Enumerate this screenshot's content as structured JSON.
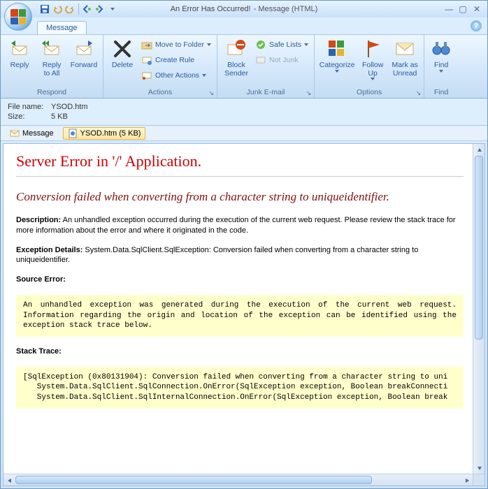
{
  "window": {
    "title_main": "An Error Has Occurred!",
    "title_sub": "- Message (HTML)"
  },
  "tabs": {
    "message": "Message"
  },
  "ribbon": {
    "respond": {
      "label": "Respond",
      "reply": "Reply",
      "reply_all": "Reply\nto All",
      "forward": "Forward"
    },
    "actions": {
      "label": "Actions",
      "delete": "Delete",
      "move_to_folder": "Move to Folder",
      "create_rule": "Create Rule",
      "other_actions": "Other Actions"
    },
    "junk": {
      "label": "Junk E-mail",
      "block": "Block\nSender",
      "safe_lists": "Safe Lists",
      "not_junk": "Not Junk"
    },
    "options": {
      "label": "Options",
      "categorize": "Categorize",
      "follow_up": "Follow\nUp",
      "mark_as_unread": "Mark as\nUnread"
    },
    "find": {
      "label": "Find",
      "find": "Find"
    }
  },
  "fileinfo": {
    "filename_label": "File name:",
    "filename": "YSOD.htm",
    "size_label": "Size:",
    "size": "5 KB"
  },
  "attachments": {
    "message_tab": "Message",
    "ysod_tab": "YSOD.htm (5 KB)"
  },
  "ysod": {
    "h1": "Server Error in '/' Application.",
    "h2": "Conversion failed when converting from a character string to uniqueidentifier.",
    "desc_label": "Description:",
    "desc": "An unhandled exception occurred during the execution of the current web request. Please review the stack trace for more information about the error and where it originated in the code.",
    "ex_label": "Exception Details:",
    "ex": "System.Data.SqlClient.SqlException: Conversion failed when converting from a character string to uniqueidentifier.",
    "src_label": "Source Error:",
    "src_box": "An unhandled exception was generated during the execution of the current web request. Information regarding the origin and location of the exception can be identified using the exception stack trace below.",
    "stack_label": "Stack Trace:",
    "stack_box": "[SqlException (0x80131904): Conversion failed when converting from a character string to uni\n   System.Data.SqlClient.SqlConnection.OnError(SqlException exception, Boolean breakConnecti\n   System.Data.SqlClient.SqlInternalConnection.OnError(SqlException exception, Boolean break"
  }
}
